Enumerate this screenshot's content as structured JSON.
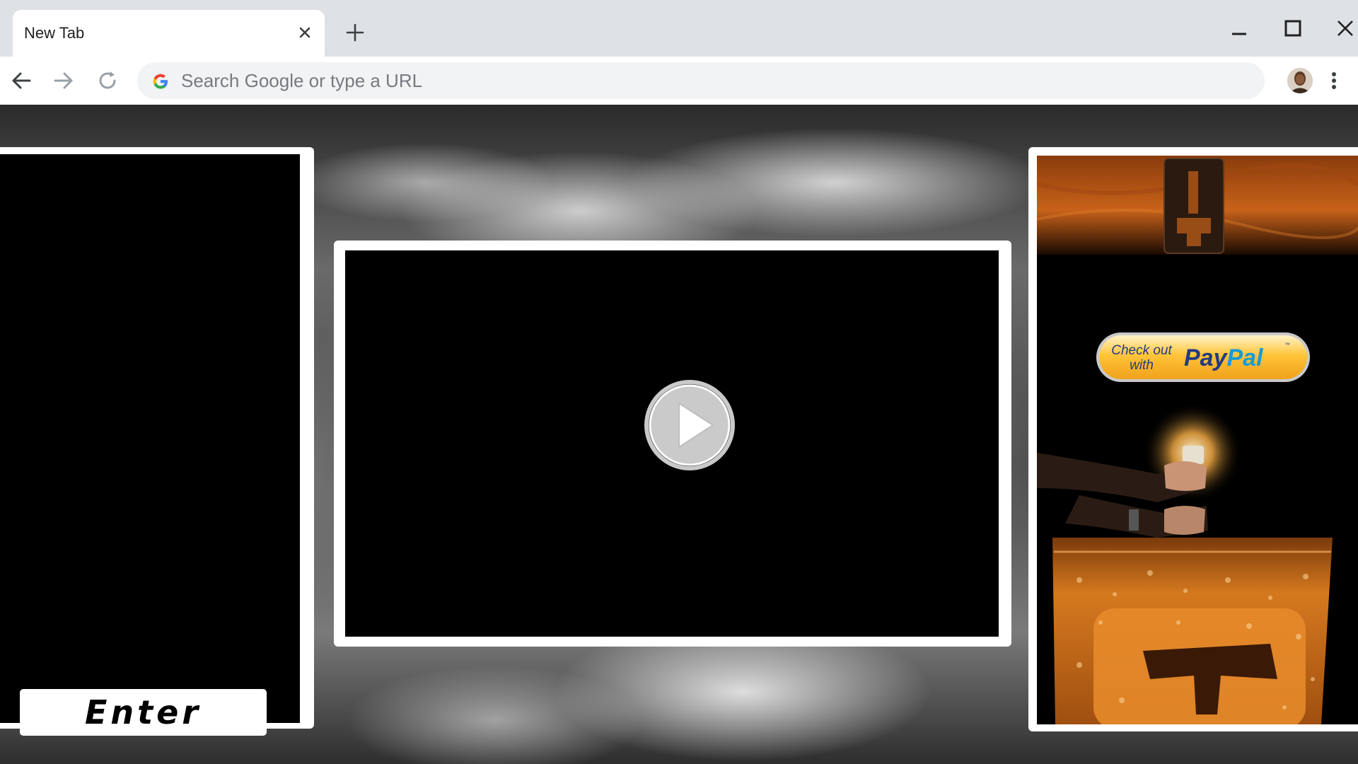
{
  "browser": {
    "tab_title": "New Tab",
    "omnibox_placeholder": "Search Google or type a URL"
  },
  "page": {
    "enter_label": "Enter",
    "paypal_checkout_text": "Check out with",
    "paypal_brand": "PayPal",
    "video_state": "paused"
  },
  "colors": {
    "chrome_frame": "#dee1e6",
    "omnibox_bg": "#f1f3f4",
    "paypal_blue": "#253b80",
    "paypal_lightblue": "#179bd7",
    "paypal_gold": "#ffc439",
    "amber_glow": "#c86a12"
  }
}
